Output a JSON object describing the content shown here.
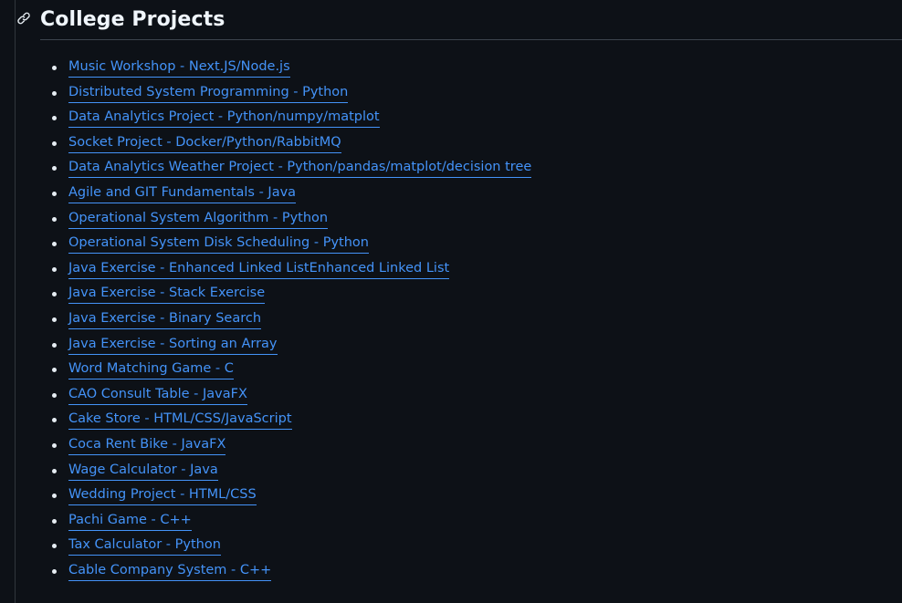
{
  "section": {
    "title": "College Projects",
    "anchor_icon": "link-icon"
  },
  "projects": [
    {
      "label": "Music Workshop - Next.JS/Node.js"
    },
    {
      "label": "Distributed System Programming - Python"
    },
    {
      "label": "Data Analytics Project - Python/numpy/matplot"
    },
    {
      "label": "Socket Project - Docker/Python/RabbitMQ"
    },
    {
      "label": "Data Analytics Weather Project - Python/pandas/matplot/decision tree"
    },
    {
      "label": "Agile and GIT Fundamentals - Java"
    },
    {
      "label": "Operational System Algorithm - Python"
    },
    {
      "label": "Operational System Disk Scheduling - Python"
    },
    {
      "label": "Java Exercise - Enhanced Linked ListEnhanced Linked List"
    },
    {
      "label": "Java Exercise - Stack Exercise"
    },
    {
      "label": "Java Exercise - Binary Search"
    },
    {
      "label": "Java Exercise - Sorting an Array"
    },
    {
      "label": "Word Matching Game - C"
    },
    {
      "label": "CAO Consult Table - JavaFX"
    },
    {
      "label": "Cake Store - HTML/CSS/JavaScript"
    },
    {
      "label": "Coca Rent Bike - JavaFX"
    },
    {
      "label": "Wage Calculator - Java"
    },
    {
      "label": "Wedding Project - HTML/CSS"
    },
    {
      "label": "Pachi Game - C++"
    },
    {
      "label": "Tax Calculator - Python"
    },
    {
      "label": "Cable Company System - C++"
    }
  ],
  "colors": {
    "background": "#0d1117",
    "link": "#4493f8",
    "text": "#e6edf3",
    "border": "#30363d"
  }
}
